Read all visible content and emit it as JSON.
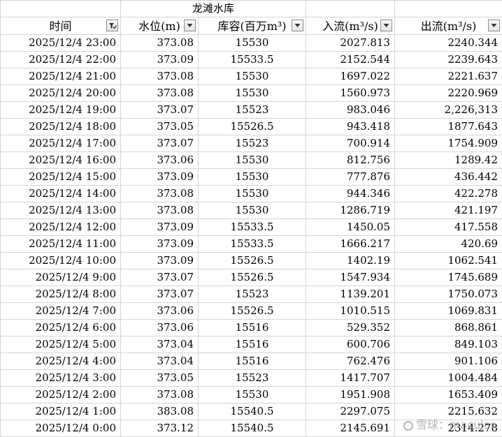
{
  "sheet": {
    "title": "龙滩水库",
    "headers": [
      "时间",
      "水位(m)",
      "库容(百万m³)",
      "入流(m³/s)",
      "出流(m³/s)"
    ],
    "time_filter_active": true,
    "rows": [
      [
        "2025/12/4 23:00",
        "373.08",
        "15530",
        "2027.813",
        "2240.344"
      ],
      [
        "2025/12/4 22:00",
        "373.09",
        "15533.5",
        "2152.544",
        "2239.643"
      ],
      [
        "2025/12/4 21:00",
        "373.08",
        "15530",
        "1697.022",
        "2221.637"
      ],
      [
        "2025/12/4 20:00",
        "373.08",
        "15530",
        "1560.973",
        "2220.969"
      ],
      [
        "2025/12/4 19:00",
        "373.07",
        "15523",
        "983.046",
        "2,226,313"
      ],
      [
        "2025/12/4 18:00",
        "373.05",
        "15526.5",
        "943.418",
        "1877.643"
      ],
      [
        "2025/12/4 17:00",
        "373.07",
        "15523",
        "700.914",
        "1754.909"
      ],
      [
        "2025/12/4 16:00",
        "373.06",
        "15530",
        "812.756",
        "1289.42"
      ],
      [
        "2025/12/4 15:00",
        "373.09",
        "15530",
        "777.876",
        "436.442"
      ],
      [
        "2025/12/4 14:00",
        "373.08",
        "15530",
        "944.346",
        "422.278"
      ],
      [
        "2025/12/4 13:00",
        "373.08",
        "15530",
        "1286.719",
        "421.197"
      ],
      [
        "2025/12/4 12:00",
        "373.09",
        "15533.5",
        "1450.05",
        "417.558"
      ],
      [
        "2025/12/4 11:00",
        "373.09",
        "15533.5",
        "1666.217",
        "420.69"
      ],
      [
        "2025/12/4 10:00",
        "373.09",
        "15526.5",
        "1402.19",
        "1062.541"
      ],
      [
        "2025/12/4 9:00",
        "373.07",
        "15526.5",
        "1547.934",
        "1745.689"
      ],
      [
        "2025/12/4 8:00",
        "373.07",
        "15523",
        "1139.201",
        "1750.073"
      ],
      [
        "2025/12/4 7:00",
        "373.06",
        "15526.5",
        "1010.515",
        "1069.831"
      ],
      [
        "2025/12/4 6:00",
        "373.06",
        "15516",
        "529.352",
        "868.861"
      ],
      [
        "2025/12/4 5:00",
        "373.04",
        "15516",
        "600.706",
        "849.103"
      ],
      [
        "2025/12/4 4:00",
        "373.04",
        "15516",
        "762.476",
        "901.106"
      ],
      [
        "2025/12/4 3:00",
        "373.05",
        "15523",
        "1417.707",
        "1004.484"
      ],
      [
        "2025/12/4 2:00",
        "373.08",
        "15530",
        "1951.908",
        "1653.409"
      ],
      [
        "2025/12/4 1:00",
        "383.08",
        "15540.5",
        "2297.075",
        "2215.632"
      ],
      [
        "2025/12/4 0:00",
        "373.12",
        "15540.5",
        "2145.691",
        "2314.278"
      ]
    ]
  },
  "watermark": {
    "text": "雪球：macular"
  }
}
